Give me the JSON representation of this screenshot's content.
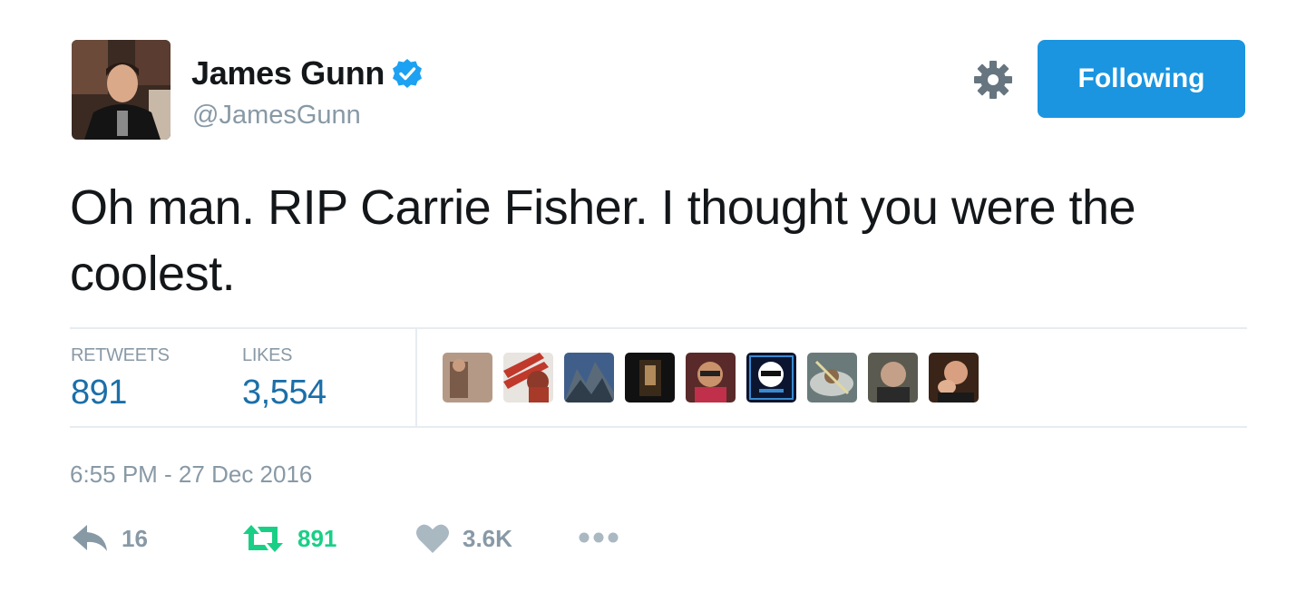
{
  "author": {
    "name": "James Gunn",
    "handle": "@JamesGunn",
    "verified": true
  },
  "follow_button": {
    "label": "Following",
    "color": "#1b95e0"
  },
  "tweet": {
    "text": "Oh man. RIP Carrie Fisher. I thought you were the coolest."
  },
  "stats": {
    "retweets_label": "RETWEETS",
    "retweets_value": "891",
    "likes_label": "LIKES",
    "likes_value": "3,554"
  },
  "likers": [
    {
      "icon": "liker-avatar-1"
    },
    {
      "icon": "liker-avatar-2"
    },
    {
      "icon": "liker-avatar-3"
    },
    {
      "icon": "liker-avatar-4"
    },
    {
      "icon": "liker-avatar-5"
    },
    {
      "icon": "liker-avatar-6"
    },
    {
      "icon": "liker-avatar-7"
    },
    {
      "icon": "liker-avatar-8"
    },
    {
      "icon": "liker-avatar-9"
    }
  ],
  "timestamp": "6:55 PM - 27 Dec 2016",
  "actions": {
    "reply_count": "16",
    "retweet_count": "891",
    "like_count": "3.6K"
  },
  "colors": {
    "accent": "#1b95e0",
    "retweet_green": "#19cf86",
    "muted": "#8899a6",
    "stat_blue": "#1b6fa8"
  }
}
